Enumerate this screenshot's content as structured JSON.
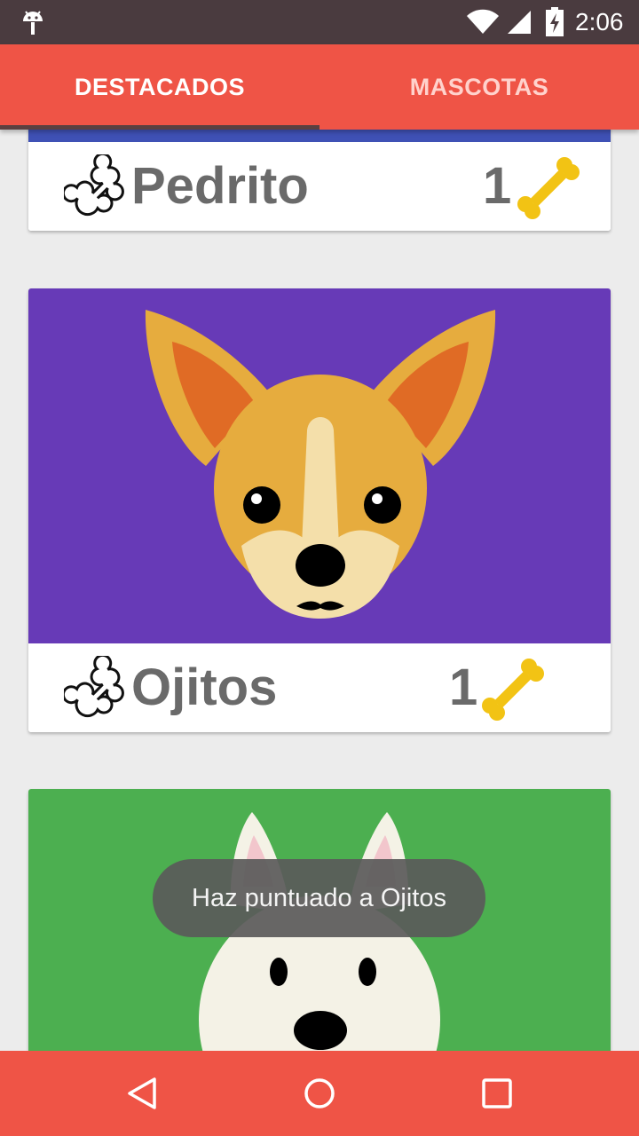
{
  "status_bar": {
    "time": "2:06",
    "icons": [
      "android-icon",
      "wifi-icon",
      "signal-icon",
      "battery-charging-icon"
    ]
  },
  "tabs": [
    {
      "label": "DESTACADOS",
      "selected": true
    },
    {
      "label": "MASCOTAS",
      "selected": false
    }
  ],
  "cards": [
    {
      "name": "Pedrito",
      "rating": "1",
      "photo_color": "#3f51b5"
    },
    {
      "name": "Ojitos",
      "rating": "1",
      "photo_color": "#673ab7"
    },
    {
      "photo_color": "#4caf50"
    }
  ],
  "toast": {
    "message": "Haz puntuado a Ojitos"
  },
  "nav_bar": {
    "icons": [
      "back-icon",
      "home-icon",
      "recents-icon"
    ]
  },
  "colors": {
    "accent": "#ef5446",
    "bone_gold": "#f2c314",
    "status_bar": "#4a3b3f"
  }
}
